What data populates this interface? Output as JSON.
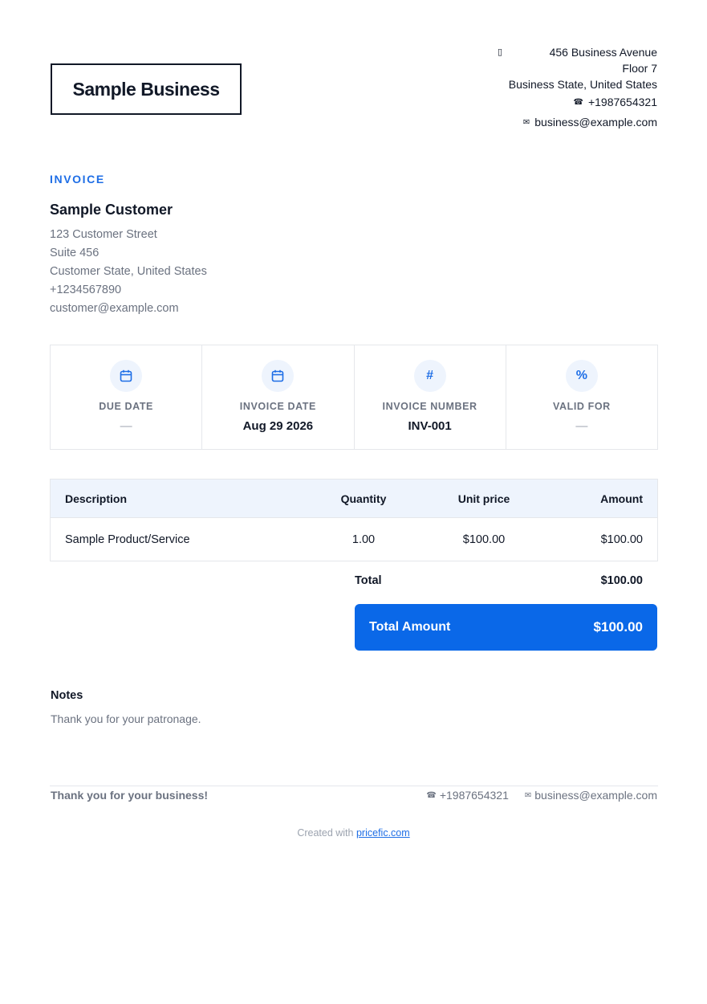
{
  "business": {
    "name": "Sample Business",
    "address": [
      "456 Business Avenue",
      "Floor 7",
      "Business State, United States"
    ],
    "phone": "+1987654321",
    "email": "business@example.com"
  },
  "document": {
    "label": "INVOICE"
  },
  "customer": {
    "name": "Sample Customer",
    "lines": [
      "123 Customer Street",
      "Suite 456",
      "Customer State, United States",
      "+1234567890",
      "customer@example.com"
    ]
  },
  "meta": [
    {
      "icon": "calendar-icon",
      "label": "DUE DATE",
      "value": "—"
    },
    {
      "icon": "calendar-icon",
      "label": "INVOICE DATE",
      "value": "Aug 29 2026"
    },
    {
      "icon": "hash-icon",
      "glyph": "#",
      "label": "INVOICE NUMBER",
      "value": "INV-001"
    },
    {
      "icon": "percent-icon",
      "glyph": "%",
      "label": "VALID FOR",
      "value": "—"
    }
  ],
  "items": {
    "headers": {
      "description": "Description",
      "quantity": "Quantity",
      "unit_price": "Unit price",
      "amount": "Amount"
    },
    "rows": [
      {
        "description": "Sample Product/Service",
        "quantity": "1.00",
        "unit_price": "$100.00",
        "amount": "$100.00"
      }
    ]
  },
  "totals": {
    "total_label": "Total",
    "total_value": "$100.00",
    "grand_label": "Total Amount",
    "grand_value": "$100.00"
  },
  "notes": {
    "title": "Notes",
    "text": "Thank you for your patronage."
  },
  "footer": {
    "thanks": "Thank you for your business!",
    "phone": "+1987654321",
    "email": "business@example.com",
    "created_prefix": "Created with",
    "created_link": "pricefic.com"
  },
  "colors": {
    "accent": "#0a68e8",
    "header_bg": "#eef4fd",
    "muted": "#6b7280"
  }
}
